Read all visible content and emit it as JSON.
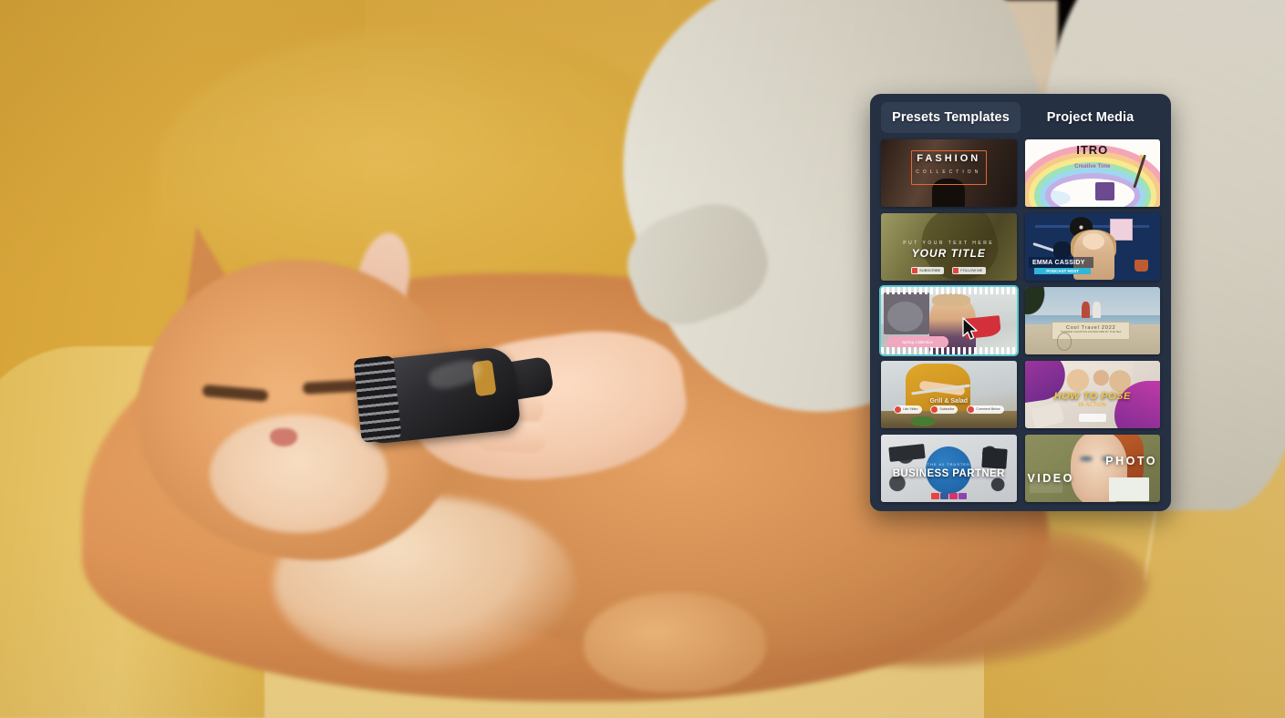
{
  "panel": {
    "tabs": [
      {
        "label": "Presets Templates",
        "active": true
      },
      {
        "label": "Project Media",
        "active": false
      }
    ],
    "accent_selected_color": "#57c7cf",
    "panel_bg_color": "#253043",
    "tab_active_bg_color": "#313d51",
    "thumbnails": [
      {
        "column": "presets",
        "row": 1,
        "title": "FASHION",
        "subtitle": "COLLECTION",
        "selected": false
      },
      {
        "column": "presets",
        "row": 2,
        "pretitle": "PUT YOUR TEXT HERE",
        "title": "YOUR TITLE",
        "chips": [
          "SUBSCRIBE",
          "FOLLOW ME"
        ],
        "selected": false
      },
      {
        "column": "presets",
        "row": 3,
        "title": "",
        "pill_label": "Spring Collection",
        "selected": true
      },
      {
        "column": "presets",
        "row": 4,
        "title": "Grill & Salad",
        "chips": [
          "Like Video",
          "Subscribe",
          "Comment Below"
        ],
        "selected": false
      },
      {
        "column": "presets",
        "row": 5,
        "smalltext": "THE #1 TRUSTED",
        "title": "BUSINESS PARTNER",
        "selected": false
      },
      {
        "column": "media",
        "row": 1,
        "title": "ITRO",
        "subtitle": "Creative Time",
        "selected": false
      },
      {
        "column": "media",
        "row": 2,
        "name_label": "EMMA CASSIDY",
        "role_label": "PODCAST HOST",
        "selected": false
      },
      {
        "column": "media",
        "row": 3,
        "sign_line1": "Cool Travel 2022",
        "sign_line2": "SUMMER VACATION ADVENTURE BY THE SEA",
        "selected": false
      },
      {
        "column": "media",
        "row": 4,
        "title": "HOW TO POSE",
        "subtitle": "IN ACTION",
        "selected": false
      },
      {
        "column": "media",
        "row": 5,
        "label_photo": "PHOTO",
        "label_video": "VIDEO",
        "selected": false
      }
    ]
  },
  "background": {
    "scene_description": "Person brushing a long-haired orange cat on a yellow couch",
    "couch_color": "#d9a83e",
    "cat_fur_color": "#dd9456",
    "sleeve_color": "#e0dcd0"
  },
  "cursor": {
    "type": "arrow-pointer"
  }
}
